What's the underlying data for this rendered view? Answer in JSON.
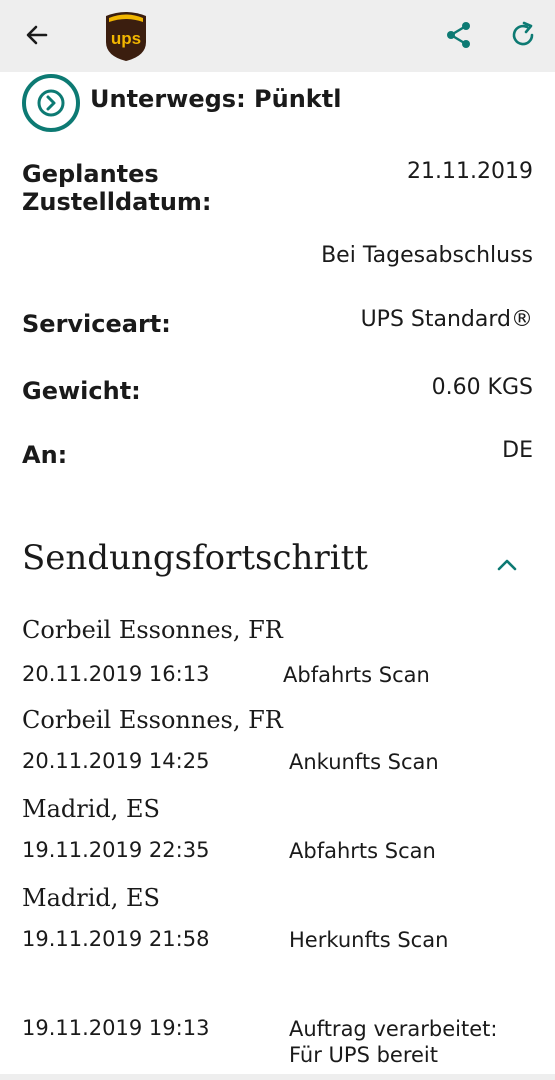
{
  "colors": {
    "accent": "#0d7a73",
    "appbar_bg": "#eeeeee",
    "ups_brown": "#3b1e0f",
    "ups_gold": "#f2b600"
  },
  "appbar": {
    "logo_text": "ups",
    "icons": [
      "back-arrow-icon",
      "ups-logo",
      "share-icon",
      "refresh-icon"
    ]
  },
  "status": {
    "text": "Unterwegs: Pünktl"
  },
  "details": {
    "planned_label": "Geplantes\nZustelldatum:",
    "planned_date": "21.11.2019",
    "planned_time": "Bei Tagesabschluss",
    "service_label": "Serviceart:",
    "service_value": "UPS Standard®",
    "weight_label": "Gewicht:",
    "weight_value": "0.60  KGS",
    "to_label": "An:",
    "to_value": "DE"
  },
  "progress": {
    "title": "Sendungsfortschritt",
    "events": [
      {
        "location": "Corbeil Essonnes, FR",
        "datetime": "20.11.2019   16:13",
        "description": "Abfahrts Scan"
      },
      {
        "location": "Corbeil Essonnes, FR",
        "datetime": "20.11.2019   14:25",
        "description": "Ankunfts Scan"
      },
      {
        "location": "Madrid, ES",
        "datetime": "19.11.2019   22:35",
        "description": "Abfahrts Scan"
      },
      {
        "location": "Madrid, ES",
        "datetime": "19.11.2019   21:58",
        "description": "Herkunfts Scan"
      },
      {
        "location": "",
        "datetime": "19.11.2019   19:13",
        "description": "Auftrag verarbeitet: Für UPS bereit"
      }
    ]
  }
}
